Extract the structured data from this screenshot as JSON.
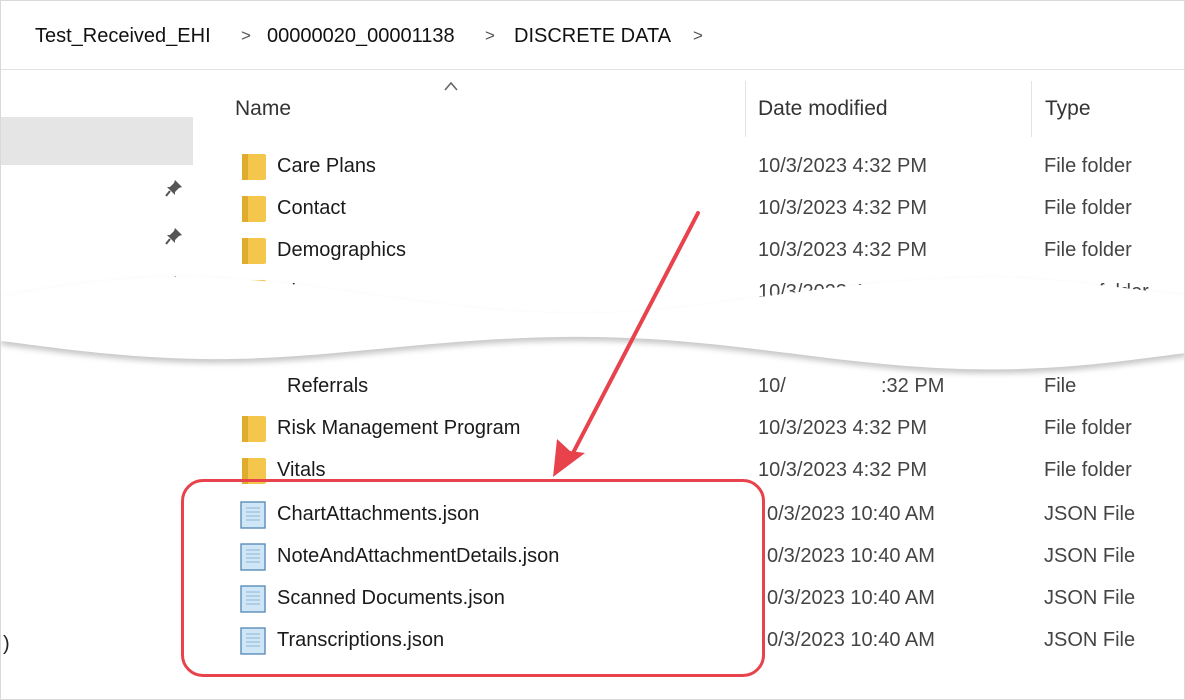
{
  "breadcrumb": {
    "items": [
      "Test_Received_EHI",
      "00000020_00001138",
      "DISCRETE DATA"
    ],
    "separator": ">"
  },
  "columns": {
    "name": "Name",
    "date_modified": "Date modified",
    "type": "Type"
  },
  "rows_top": [
    {
      "name": "Care Plans",
      "date": "10/3/2023 4:32 PM",
      "type": "File folder",
      "icon": "folder-icon"
    },
    {
      "name": "Contact",
      "date": "10/3/2023 4:32 PM",
      "type": "File folder",
      "icon": "folder-icon"
    },
    {
      "name": "Demographics",
      "date": "10/3/2023 4:32 PM",
      "type": "File folder",
      "icon": "folder-icon"
    },
    {
      "name": "Dia",
      "date": "10/3/2023 4:3",
      "type": "File folder",
      "icon": "folder-icon"
    }
  ],
  "rows_bottom": [
    {
      "name": "Referrals",
      "date": "10/",
      "date_tail": ":32 PM",
      "type": "File",
      "icon": "folder-icon"
    },
    {
      "name": "Risk Management Program",
      "date": "10/3/2023 4:32 PM",
      "type": "File folder",
      "icon": "folder-icon"
    },
    {
      "name": "Vitals",
      "date": "10/3/2023 4:32 PM",
      "type": "File folder",
      "icon": "folder-icon"
    }
  ],
  "rows_json": [
    {
      "name": "ChartAttachments.json",
      "date": "0/3/2023 10:40 AM",
      "type": "JSON File",
      "icon": "json-file-icon"
    },
    {
      "name": "NoteAndAttachmentDetails.json",
      "date": "0/3/2023 10:40 AM",
      "type": "JSON File",
      "icon": "json-file-icon"
    },
    {
      "name": "Scanned Documents.json",
      "date": "0/3/2023 10:40 AM",
      "type": "JSON File",
      "icon": "json-file-icon"
    },
    {
      "name": "Transcriptions.json",
      "date": "0/3/2023 10:40 AM",
      "type": "JSON File",
      "icon": "json-file-icon"
    }
  ],
  "nav": {
    "edge_mark": ")"
  },
  "colors": {
    "highlight": "#e8424c",
    "folder": "#f4c64c",
    "selected": "#e5e5e5"
  }
}
